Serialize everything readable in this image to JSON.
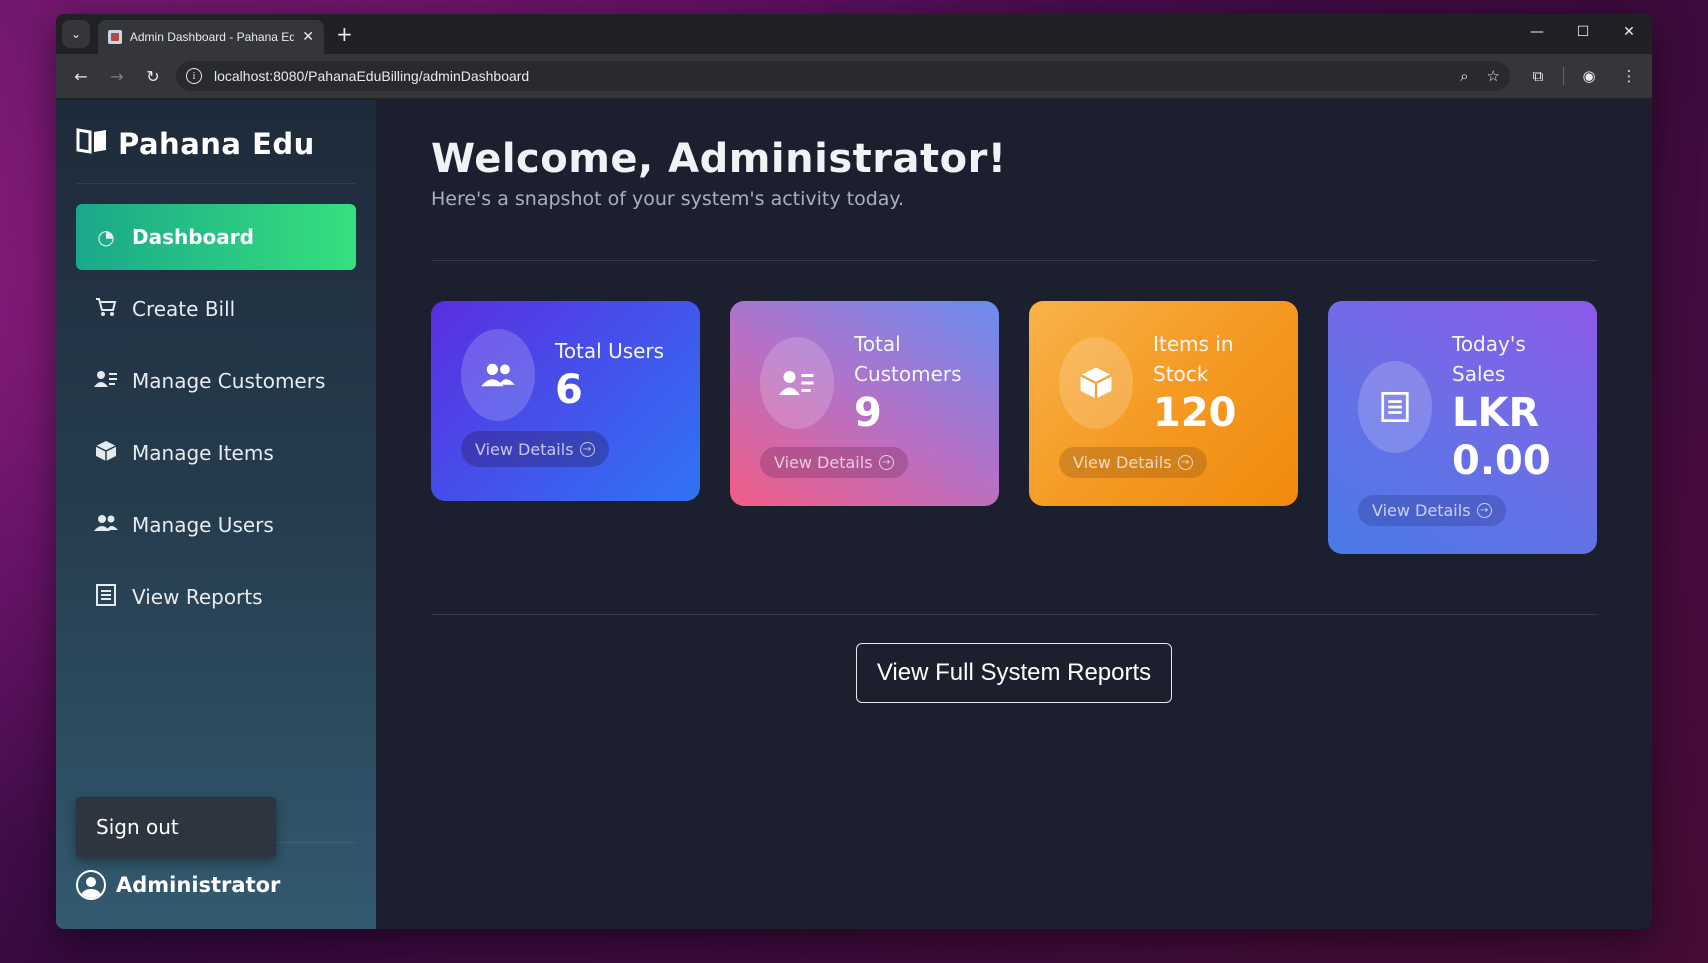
{
  "browser": {
    "tab_title": "Admin Dashboard - Pahana Edu",
    "url": "localhost:8080/PahanaEduBilling/adminDashboard",
    "icons": [
      "tab-search-icon",
      "close-icon",
      "plus-icon",
      "minimize-icon",
      "maximize-icon",
      "window-close-icon",
      "back-icon",
      "forward-icon",
      "reload-icon",
      "site-info-icon",
      "zoom-icon",
      "star-icon",
      "extensions-icon",
      "profile-icon",
      "menu-icon"
    ]
  },
  "sidebar": {
    "brand": "Pahana Edu",
    "items": [
      {
        "label": "Dashboard",
        "icon": "gauge-icon",
        "active": true
      },
      {
        "label": "Create Bill",
        "icon": "cart-icon",
        "active": false
      },
      {
        "label": "Manage Customers",
        "icon": "address-card-icon",
        "active": false
      },
      {
        "label": "Manage Items",
        "icon": "box-icon",
        "active": false
      },
      {
        "label": "Manage Users",
        "icon": "users-icon",
        "active": false
      },
      {
        "label": "View Reports",
        "icon": "receipt-icon",
        "active": false
      }
    ],
    "signout_label": "Sign out",
    "user_name": "Administrator"
  },
  "main": {
    "welcome": "Welcome, Administrator!",
    "subtitle": "Here's a snapshot of your system's activity today.",
    "cards": [
      {
        "label": "Total Users",
        "value": "6",
        "button": "View Details",
        "icon": "users-icon"
      },
      {
        "label": "Total Customers",
        "value": "9",
        "button": "View Details",
        "icon": "address-card-icon"
      },
      {
        "label": "Items in Stock",
        "value": "120",
        "button": "View Details",
        "icon": "box-icon"
      },
      {
        "label": "Today's Sales",
        "value": "LKR 0.00",
        "button": "View Details",
        "icon": "receipt-icon"
      }
    ],
    "report_button": "View Full System Reports"
  },
  "colors": {
    "sidebar_active_start": "#1aa88a",
    "sidebar_active_end": "#36e07e",
    "main_bg": "#1c1f2e",
    "card_users": "#2f74f5",
    "card_customers": "#f25d85",
    "card_items": "#f59a23",
    "card_sales": "#6a6fe6"
  }
}
